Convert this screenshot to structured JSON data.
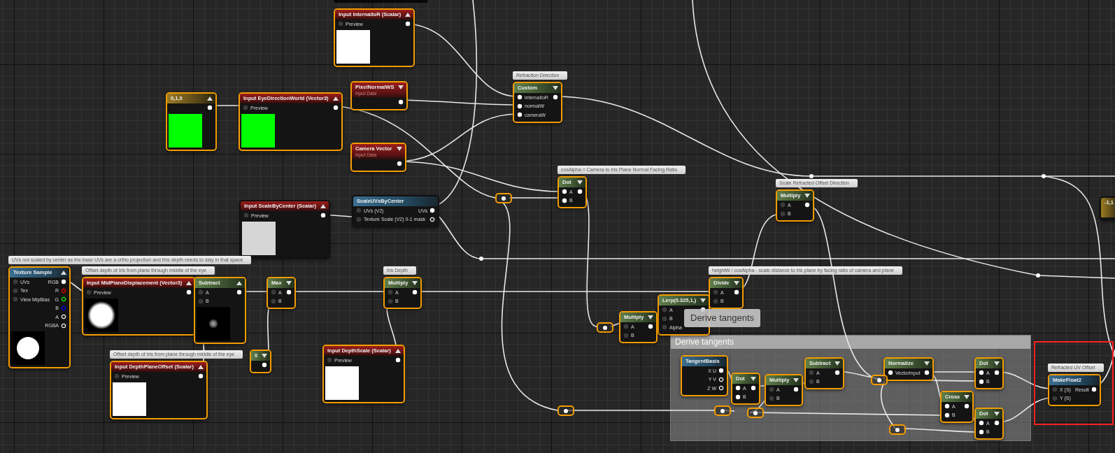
{
  "nodes": [
    {
      "title": "Input InternalIoR (Scalar)",
      "kind": "input",
      "selected": true,
      "preview_shown": true,
      "pins_in": [
        {
          "label": "Preview",
          "connected": false
        }
      ],
      "pins_out": [
        {
          "connected": true
        }
      ],
      "preview": {
        "kind": "solid",
        "color": "#ffffff"
      }
    },
    {
      "title": "PixelNormalWS",
      "subtitle": "Input Data",
      "kind": "input",
      "selected": true,
      "preview_shown": false,
      "pins_out": [
        {
          "connected": true
        }
      ]
    },
    {
      "title": "Custom",
      "comment": "Refraction Direction",
      "kind": "math",
      "selected": true,
      "preview_shown": false,
      "pins_in": [
        {
          "label": "internalIoR",
          "connected": true
        },
        {
          "label": "normalW",
          "connected": true
        },
        {
          "label": "cameraW",
          "connected": true
        }
      ],
      "pins_out": [
        {
          "connected": true
        }
      ]
    },
    {
      "title": "0,1,0",
      "kind": "constant",
      "selected": true,
      "preview_shown": true,
      "pins_out": [
        {
          "connected": true
        }
      ],
      "preview": {
        "kind": "solid",
        "color": "#00ff00"
      }
    },
    {
      "title": "Input EyeDirectionWorld (Vector3)",
      "kind": "input",
      "selected": true,
      "preview_shown": true,
      "pins_in": [
        {
          "label": "Preview",
          "connected": false
        }
      ],
      "pins_out": [
        {
          "connected": true
        }
      ],
      "preview": {
        "kind": "solid",
        "color": "#00ff00"
      }
    },
    {
      "title": "Camera Vector",
      "subtitle": "Input Data",
      "kind": "input",
      "selected": true,
      "preview_shown": false,
      "pins_out": [
        {
          "connected": true
        }
      ]
    },
    {
      "title": "Dot",
      "comment": "cosAlpha = Camera to Iris Plane Normal Facing Ratio",
      "kind": "math",
      "selected": true,
      "preview_shown": false,
      "pins_in": [
        {
          "label": "A",
          "connected": true
        },
        {
          "label": "B",
          "connected": true
        }
      ],
      "pins_out": [
        {
          "connected": true
        }
      ]
    },
    {
      "title": "Multiply",
      "comment": "Scale Refracted Offset Direction",
      "kind": "math",
      "selected": true,
      "preview_shown": false,
      "pins_in": [
        {
          "label": "A",
          "connected": false
        },
        {
          "label": "B",
          "connected": false
        }
      ],
      "pins_out": [
        {
          "connected": true
        }
      ]
    },
    {
      "title": "ScaleUVsByCenter",
      "kind": "function",
      "selected": false,
      "pins_in": [
        {
          "label": "UVs (V2)",
          "connected": false
        },
        {
          "label": "Texture Scale (V2) 0-1 mask",
          "connected": false
        }
      ],
      "pins_out": [
        {
          "label": "UVs",
          "connected": true
        },
        {
          "connected": false
        }
      ]
    },
    {
      "title": "-1,1",
      "kind": "constant",
      "selected": false
    },
    {
      "title": "Input ScaleByCenter (Scalar)",
      "kind": "input",
      "selected": false,
      "preview_shown": true,
      "pins_in": [
        {
          "label": "Preview",
          "connected": false
        }
      ],
      "pins_out": [
        {
          "connected": true
        }
      ],
      "preview": {
        "kind": "solid",
        "color": "#d6d6d6"
      }
    },
    {
      "title": "Texture Sample",
      "comment": "UVs not scaled by center as the base UVs are a ortho projection and this depth needs to stay in that space",
      "kind": "function",
      "selected": true,
      "preview_shown": true,
      "pins_in": [
        {
          "label": "UVs",
          "connected": false
        },
        {
          "label": "Tex",
          "connected": false
        },
        {
          "label": "View MipBias",
          "connected": false
        }
      ],
      "pins_out": [
        {
          "label": "RGB",
          "connected": true
        },
        {
          "label": "R",
          "connected": false,
          "color": "#ff0000"
        },
        {
          "label": "G",
          "connected": false,
          "color": "#00ff00"
        },
        {
          "label": "B",
          "connected": false,
          "color": "#0000ff"
        },
        {
          "label": "A",
          "connected": false
        },
        {
          "label": "RGBA",
          "connected": false
        }
      ],
      "preview": {
        "kind": "disc"
      }
    },
    {
      "title": "Input MidPlaneDisplacement (Vector3)",
      "comment": "Offset depth of Iris from plane through middle of the eye",
      "kind": "input",
      "selected": true,
      "preview_shown": true,
      "pins_in": [
        {
          "label": "Preview",
          "connected": false
        }
      ],
      "pins_out": [
        {
          "connected": true
        }
      ],
      "preview": {
        "kind": "soft_disc"
      }
    },
    {
      "title": "Subtract",
      "kind": "math",
      "selected": true,
      "preview_shown": true,
      "pins_in": [
        {
          "label": "A",
          "connected": false
        },
        {
          "label": "B",
          "connected": false
        }
      ],
      "pins_out": [
        {
          "connected": true
        }
      ],
      "preview": {
        "kind": "dot"
      }
    },
    {
      "title": "Max",
      "kind": "math",
      "selected": true,
      "preview_shown": false,
      "pins_in": [
        {
          "label": "A",
          "connected": false
        },
        {
          "label": "B",
          "connected": false
        }
      ],
      "pins_out": [
        {
          "connected": true
        }
      ]
    },
    {
      "title": "Multiply",
      "comment": "Iris Depth",
      "kind": "math",
      "selected": true,
      "preview_shown": false,
      "pins_in": [
        {
          "label": "A",
          "connected": false
        },
        {
          "label": "B",
          "connected": false
        }
      ],
      "pins_out": [
        {
          "connected": true
        }
      ]
    },
    {
      "title": "Divide",
      "comment": "heightW / cosAlpha - scale distance to iris plane by facing ratio of camera and plane",
      "kind": "math",
      "selected": true,
      "preview_shown": false,
      "pins_in": [
        {
          "label": "A",
          "connected": false
        },
        {
          "label": "B",
          "connected": false
        }
      ],
      "pins_out": [
        {
          "connected": true
        }
      ]
    },
    {
      "title": "Lerp(0.325,1,)",
      "kind": "math",
      "selected": true,
      "preview_shown": false,
      "pins_in": [
        {
          "label": "A",
          "connected": false
        },
        {
          "label": "B",
          "connected": false
        },
        {
          "label": "Alpha",
          "connected": false
        }
      ],
      "pins_out": [
        {
          "connected": true
        }
      ]
    },
    {
      "title": "Multiply",
      "kind": "math",
      "selected": true,
      "preview_shown": false,
      "pins_in": [
        {
          "label": "A",
          "connected": false
        },
        {
          "label": "B",
          "connected": false
        }
      ],
      "pins_out": [
        {
          "connected": true
        }
      ]
    },
    {
      "title": "Input DepthPlaneOffset (Scalar)",
      "comment": "Offset depth of Iris from plane through middle of the eye",
      "kind": "input",
      "selected": true,
      "preview_shown": true,
      "pins_in": [
        {
          "label": "Preview",
          "connected": false
        }
      ],
      "pins_out": [
        {
          "connected": true
        }
      ],
      "preview": {
        "kind": "solid",
        "color": "#ffffff"
      }
    },
    {
      "title": "0",
      "kind": "math",
      "selected": true,
      "preview_shown": false,
      "pins_out": [
        {
          "connected": true
        }
      ]
    },
    {
      "title": "Input DepthScale (Scalar)",
      "kind": "input",
      "selected": true,
      "preview_shown": true,
      "pins_in": [
        {
          "label": "Preview",
          "connected": false
        }
      ],
      "pins_out": [
        {
          "connected": true
        }
      ],
      "preview": {
        "kind": "solid",
        "color": "#ffffff"
      }
    },
    {
      "title": "TangentBasis",
      "kind": "function",
      "selected": true,
      "pins_out": [
        {
          "label": "X U",
          "connected": true
        },
        {
          "label": "Y V",
          "connected": false
        },
        {
          "label": "Z W",
          "connected": false
        }
      ]
    },
    {
      "title": "Subtract",
      "kind": "math",
      "selected": true,
      "preview_shown": false,
      "pins_in": [
        {
          "label": "A",
          "connected": false
        },
        {
          "label": "B",
          "connected": false
        }
      ],
      "pins_out": [
        {
          "connected": true
        }
      ]
    },
    {
      "title": "Normalize",
      "kind": "math",
      "selected": true,
      "preview_shown": false,
      "pins_in": [
        {
          "label": "VectorInput",
          "connected": true
        }
      ],
      "pins_out": [
        {
          "connected": true
        }
      ]
    },
    {
      "title": "Dot",
      "kind": "math",
      "selected": true,
      "preview_shown": false,
      "pins_in": [
        {
          "label": "A",
          "connected": true
        },
        {
          "label": "B",
          "connected": true
        }
      ],
      "pins_out": [
        {
          "connected": true
        }
      ]
    },
    {
      "title": "Dot",
      "kind": "math",
      "selected": true,
      "preview_shown": false,
      "pins_in": [
        {
          "label": "A",
          "connected": true
        },
        {
          "label": "B",
          "connected": true
        }
      ],
      "pins_out": [
        {
          "connected": true
        }
      ]
    },
    {
      "title": "Multiply",
      "kind": "math",
      "selected": true,
      "preview_shown": false,
      "pins_in": [
        {
          "label": "A",
          "connected": false
        },
        {
          "label": "B",
          "connected": false
        }
      ],
      "pins_out": [
        {
          "connected": true
        }
      ]
    },
    {
      "title": "MakeFloat2",
      "comment": "Refracted UV Offset",
      "kind": "function",
      "selected": true,
      "pins_in": [
        {
          "label": "X (S)",
          "connected": false
        },
        {
          "label": "Y (S)",
          "connected": false
        }
      ],
      "pins_out": [
        {
          "label": "Result",
          "connected": true
        }
      ]
    },
    {
      "title": "Cross",
      "kind": "math",
      "selected": true,
      "preview_shown": false,
      "pins_in": [
        {
          "label": "A",
          "connected": true
        },
        {
          "label": "B",
          "connected": true
        }
      ],
      "pins_out": [
        {
          "connected": true
        }
      ]
    },
    {
      "title": "Dot",
      "kind": "math",
      "selected": true,
      "preview_shown": false,
      "pins_in": [
        {
          "label": "A",
          "connected": true
        },
        {
          "label": "B",
          "connected": true
        }
      ],
      "pins_out": [
        {
          "connected": true
        }
      ]
    }
  ],
  "comment_box": {
    "title": "Derive tangents"
  },
  "tooltip": {
    "text": "Derive tangents"
  },
  "reroute_knots": [
    {
      "selected": true
    },
    {
      "selected": true
    },
    {
      "selected": true
    },
    {
      "selected": true
    },
    {
      "selected": true
    },
    {
      "selected": true
    },
    {
      "selected": true
    }
  ]
}
